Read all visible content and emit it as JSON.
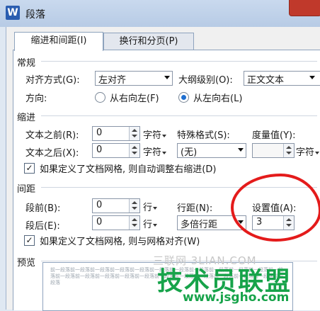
{
  "window": {
    "title": "段落",
    "app_icon_letter": "W"
  },
  "tabs": [
    {
      "label": "缩进和间距(I)",
      "active": true
    },
    {
      "label": "换行和分页(P)",
      "active": false
    }
  ],
  "general": {
    "heading": "常规",
    "alignment_label": "对齐方式(G):",
    "alignment_value": "左对齐",
    "outline_label": "大纲级别(O):",
    "outline_value": "正文文本",
    "direction_label": "方向:",
    "direction_rtl": "从右向左(F)",
    "direction_ltr": "从左向右(L)",
    "direction_selected": "ltr"
  },
  "indent": {
    "heading": "缩进",
    "before_label": "文本之前(R):",
    "before_value": "0",
    "before_unit": "字符",
    "after_label": "文本之后(X):",
    "after_value": "0",
    "after_unit": "字符",
    "special_label": "特殊格式(S):",
    "special_value": "(无)",
    "measure_label": "度量值(Y):",
    "measure_value": "",
    "measure_unit": "字符",
    "grid_checkbox": "如果定义了文档网格, 则自动调整右缩进(D)",
    "grid_checked": true
  },
  "spacing": {
    "heading": "间距",
    "before_label": "段前(B):",
    "before_value": "0",
    "before_unit": "行",
    "after_label": "段后(E):",
    "after_value": "0",
    "after_unit": "行",
    "line_label": "行距(N):",
    "line_value": "多倍行距",
    "setting_label": "设置值(A):",
    "setting_value": "3",
    "grid_checkbox": "如果定义了文档网格, 则与网格对齐(W)",
    "grid_checked": true
  },
  "preview": {
    "heading": "预览",
    "sample_text": "前一段落前一段落前一段落前一段落前一段落前一段落前一段落前一段落前一段落前一段落前一段落前一段落前一段落前一段落前一段落前一段落前一段落前一段落前一段落前一段落前一段落前一段落前一段落前一段落"
  },
  "watermark": {
    "line1": "三联网 3LIAN.COM",
    "line2": "技术员联盟",
    "line3": "www.jsgho.com"
  },
  "colors": {
    "annotation_circle": "#e41b1b",
    "watermark_green": "#17a34a"
  }
}
